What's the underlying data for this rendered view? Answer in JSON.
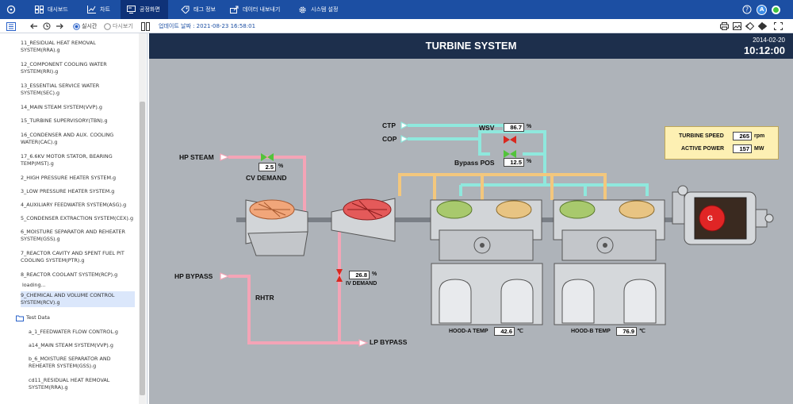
{
  "topnav": {
    "items": [
      {
        "label": "대시보드",
        "icon": "grid-icon"
      },
      {
        "label": "차트",
        "icon": "chart-icon"
      },
      {
        "label": "공정화면",
        "icon": "screen-icon"
      },
      {
        "label": "태그 정보",
        "icon": "tag-icon"
      },
      {
        "label": "데이터 내보내기",
        "icon": "export-icon"
      },
      {
        "label": "시스템 설정",
        "icon": "gear-icon"
      }
    ],
    "active": "공정화면",
    "user_initial": "A"
  },
  "toolbar": {
    "realtime_label": "실시간",
    "replay_label": "다시보기",
    "mode": "realtime",
    "update_time": "업데이트 날짜 : 2021-08-23 16:58:01"
  },
  "sidebar": {
    "items": [
      "11_RESIDUAL HEAT REMOVAL SYSTEM(RRA).g",
      "12_COMPONENT COOLING WATER SYSTEM(RRI).g",
      "13_ESSENTIAL SERVICE WATER SYSTEM(SEC).g",
      "14_MAIN STEAM SYSTEM(VVP).g",
      "15_TURBINE SUPERVISORY(TBN).g",
      "16_CONDENSER AND AUX. COOLING WATER(CAC).g",
      "17_6.6KV MOTOR STATOR, BEARING TEMP(MST).g",
      "2_HIGH PRESSURE HEATER SYSTEM.g",
      "3_LOW PRESSURE HEATER SYSTEM.g",
      "4_AUXILIARY FEEDWATER SYSTEM(ASG).g",
      "5_CONDENSER EXTRACTION SYSTEM(CEX).g",
      "6_MOISTURE SEPARATOR AND REHEATER SYSTEM(GSS).g",
      "7_REACTOR CAVITY AND SPENT FUEL PIT COOLING SYSTEM(PTR).g",
      "8_REACTOR COOLANT SYSTEM(RCP).g",
      "loading...",
      "9_CHEMICAL AND VOLUME CONTROL SYSTEM(RCV).g"
    ],
    "selected_index": 15,
    "folder_label": "Test Data",
    "folder_items": [
      "a_1_FEEDWATER FLOW CONTROL.g",
      "a14_MAIN STEAM SYSTEM(VVP).g",
      "b_6_MOISTURE SEPARATOR AND REHEATER SYSTEM(GSS).g",
      "cd11_RESIDUAL HEAT REMOVAL SYSTEM(RRA).g"
    ]
  },
  "diagram": {
    "title": "TURBINE SYSTEM",
    "date": "2014-02-20",
    "time": "10:12:00",
    "labels": {
      "ctp": "CTP",
      "cop": "COP",
      "wsv": "WSV",
      "bypass_pos": "Bypass POS",
      "hp_steam": "HP STEAM",
      "cv_demand": "CV DEMAND",
      "hp_bypass": "HP BYPASS",
      "rhtr": "RHTR",
      "iv_demand": "IV DEMAND",
      "lp_bypass": "LP BYPASS",
      "hood_a": "HOOD-A TEMP",
      "hood_b": "HOOD-B TEMP",
      "turbine_speed": "TURBINE SPEED",
      "active_power": "ACTIVE POWER",
      "generator": "G"
    },
    "values": {
      "wsv": "86.7",
      "bypass_pos": "12.5",
      "cv_demand": "2.5",
      "iv_demand": "26.8",
      "hood_a": "42.6",
      "hood_b": "76.9",
      "turbine_speed": "265",
      "active_power": "157"
    },
    "units": {
      "percent": "%",
      "temp": "℃",
      "rpm": "rpm",
      "mw": "MW"
    },
    "colors": {
      "header": "#1d2f4c",
      "background": "#aeb3b9",
      "pink_pipe": "#f4a4b6",
      "cyan_pipe": "#8fe8dd",
      "orange_pipe": "#f3c77d",
      "panel": "#fdf0b3",
      "generator": "#e02525",
      "valve_green": "#52c33b",
      "valve_red": "#d9281f"
    }
  }
}
